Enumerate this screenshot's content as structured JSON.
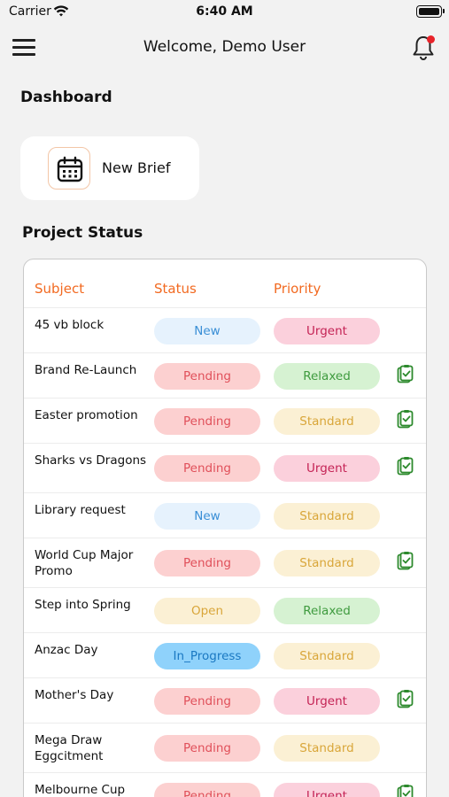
{
  "status_bar": {
    "carrier": "Carrier",
    "time": "6:40 AM"
  },
  "header": {
    "title": "Welcome, Demo  User"
  },
  "dashboard": {
    "title": "Dashboard"
  },
  "new_brief": {
    "label": "New Brief",
    "icon": "calendar-icon"
  },
  "project_status": {
    "title": "Project Status",
    "columns": [
      "Subject",
      "Status",
      "Priority"
    ],
    "rows": [
      {
        "subject": "45 vb block",
        "status": "New",
        "priority": "Urgent",
        "action": false
      },
      {
        "subject": "Brand Re-Launch",
        "status": "Pending",
        "priority": "Relaxed",
        "action": true
      },
      {
        "subject": "Easter promotion",
        "status": "Pending",
        "priority": "Standard",
        "action": true
      },
      {
        "subject": "Sharks vs Dragons",
        "status": "Pending",
        "priority": "Urgent",
        "action": true
      },
      {
        "subject": "Library request",
        "status": "New",
        "priority": "Standard",
        "action": false
      },
      {
        "subject": "World Cup Major Promo",
        "status": "Pending",
        "priority": "Standard",
        "action": true
      },
      {
        "subject": "Step into Spring",
        "status": "Open",
        "priority": "Relaxed",
        "action": false
      },
      {
        "subject": "Anzac Day",
        "status": "In_Progress",
        "priority": "Standard",
        "action": false
      },
      {
        "subject": "Mother's Day",
        "status": "Pending",
        "priority": "Urgent",
        "action": true
      },
      {
        "subject": "Mega Draw Eggcitment",
        "status": "Pending",
        "priority": "Standard",
        "action": false
      },
      {
        "subject": "Melbourne Cup",
        "status": "Pending",
        "priority": "Urgent",
        "action": true
      }
    ]
  },
  "colors": {
    "accent": "#f26a21",
    "status": {
      "New": {
        "bg": "#e6f2fd",
        "fg": "#3a8fd6"
      },
      "Pending": {
        "bg": "#fcd0d0",
        "fg": "#e0505a"
      },
      "Open": {
        "bg": "#fbf0d4",
        "fg": "#d9a63a"
      },
      "In_Progress": {
        "bg": "#8fd2fb",
        "fg": "#1a78c2"
      }
    },
    "priority": {
      "Urgent": {
        "bg": "#fbd0dc",
        "fg": "#c42355"
      },
      "Relaxed": {
        "bg": "#d6f2d2",
        "fg": "#3f9b3f"
      },
      "Standard": {
        "bg": "#fbf0d4",
        "fg": "#d9a63a"
      }
    },
    "action_icon": "#2d8a2d"
  }
}
